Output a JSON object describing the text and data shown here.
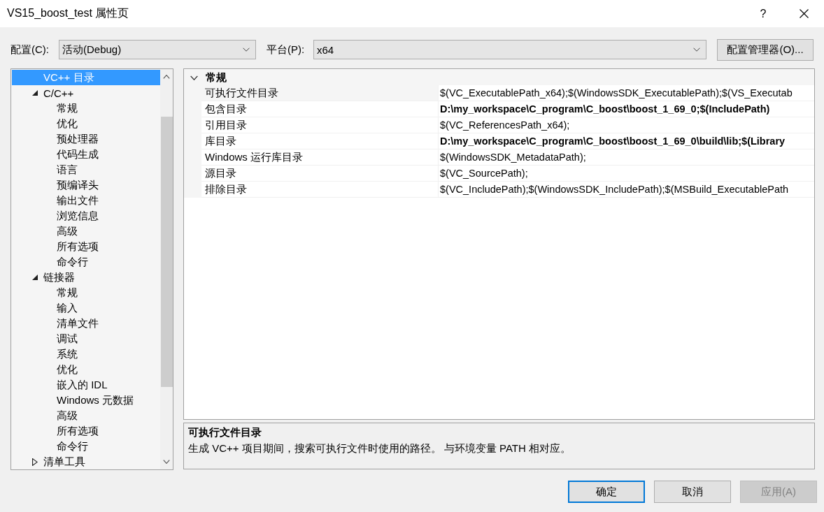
{
  "window": {
    "title": "VS15_boost_test 属性页",
    "help": "?"
  },
  "toolbar": {
    "configuration": {
      "label": "配置(C):",
      "value": "活动(Debug)"
    },
    "platform": {
      "label": "平台(P):",
      "value": "x64"
    },
    "manager_button": "配置管理器(O)..."
  },
  "tree": {
    "items": [
      {
        "label": "VC++ 目录",
        "kind": "page",
        "selected": true
      },
      {
        "label": "C/C++",
        "kind": "group",
        "expanded": true,
        "selected": false,
        "children": [
          {
            "label": "常规",
            "kind": "page",
            "selected": false
          },
          {
            "label": "优化",
            "kind": "page",
            "selected": false
          },
          {
            "label": "预处理器",
            "kind": "page",
            "selected": false
          },
          {
            "label": "代码生成",
            "kind": "page",
            "selected": false
          },
          {
            "label": "语言",
            "kind": "page",
            "selected": false
          },
          {
            "label": "预编译头",
            "kind": "page",
            "selected": false
          },
          {
            "label": "输出文件",
            "kind": "page",
            "selected": false
          },
          {
            "label": "浏览信息",
            "kind": "page",
            "selected": false
          },
          {
            "label": "高级",
            "kind": "page",
            "selected": false
          },
          {
            "label": "所有选项",
            "kind": "page",
            "selected": false
          },
          {
            "label": "命令行",
            "kind": "page",
            "selected": false
          }
        ]
      },
      {
        "label": "链接器",
        "kind": "group",
        "expanded": true,
        "selected": false,
        "children": [
          {
            "label": "常规",
            "kind": "page",
            "selected": false
          },
          {
            "label": "输入",
            "kind": "page",
            "selected": false
          },
          {
            "label": "清单文件",
            "kind": "page",
            "selected": false
          },
          {
            "label": "调试",
            "kind": "page",
            "selected": false
          },
          {
            "label": "系统",
            "kind": "page",
            "selected": false
          },
          {
            "label": "优化",
            "kind": "page",
            "selected": false
          },
          {
            "label": "嵌入的 IDL",
            "kind": "page",
            "selected": false
          },
          {
            "label": "Windows 元数据",
            "kind": "page",
            "selected": false
          },
          {
            "label": "高级",
            "kind": "page",
            "selected": false
          },
          {
            "label": "所有选项",
            "kind": "page",
            "selected": false
          },
          {
            "label": "命令行",
            "kind": "page",
            "selected": false
          }
        ]
      },
      {
        "label": "清单工具",
        "kind": "group",
        "expanded": false,
        "selected": false
      }
    ]
  },
  "property_grid": {
    "categories": [
      {
        "label": "常规",
        "expanded": true,
        "properties": [
          {
            "name": "可执行文件目录",
            "value": "$(VC_ExecutablePath_x64);$(WindowsSDK_ExecutablePath);$(VS_Executab",
            "bold": false,
            "selected": true
          },
          {
            "name": "包含目录",
            "value": "D:\\my_workspace\\C_program\\C_boost\\boost_1_69_0;$(IncludePath)",
            "bold": true,
            "selected": false
          },
          {
            "name": "引用目录",
            "value": "$(VC_ReferencesPath_x64);",
            "bold": false,
            "selected": false
          },
          {
            "name": "库目录",
            "value": "D:\\my_workspace\\C_program\\C_boost\\boost_1_69_0\\build\\lib;$(Library",
            "bold": true,
            "selected": false
          },
          {
            "name": "Windows 运行库目录",
            "value": "$(WindowsSDK_MetadataPath);",
            "bold": false,
            "selected": false
          },
          {
            "name": "源目录",
            "value": "$(VC_SourcePath);",
            "bold": false,
            "selected": false
          },
          {
            "name": "排除目录",
            "value": "$(VC_IncludePath);$(WindowsSDK_IncludePath);$(MSBuild_ExecutablePath",
            "bold": false,
            "selected": false
          }
        ]
      }
    ]
  },
  "description": {
    "title": "可执行文件目录",
    "text": "生成 VC++ 项目期间，搜索可执行文件时使用的路径。 与环境变量 PATH 相对应。"
  },
  "buttons": [
    {
      "label": "确定",
      "default": true,
      "disabled": false
    },
    {
      "label": "取消",
      "default": false,
      "disabled": false
    },
    {
      "label": "应用(A)",
      "default": false,
      "disabled": true
    }
  ]
}
